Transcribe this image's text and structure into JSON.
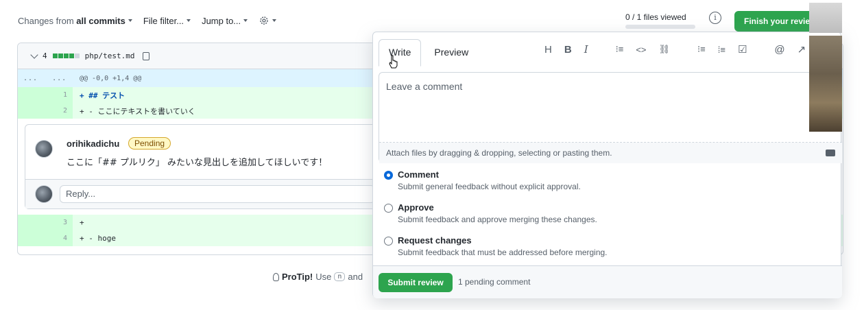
{
  "toolbar": {
    "changes_from": "Changes from",
    "all_commits": "all commits",
    "file_filter": "File filter...",
    "jump_to": "Jump to...",
    "files_viewed": "0 / 1 files viewed",
    "files_viewed_progress": 0,
    "finish_review": "Finish your revie"
  },
  "file": {
    "changes_count": "4",
    "diffstat_added_blocks": 4,
    "path": "php/test.md",
    "hunk_dots_left": "...",
    "hunk_dots_right": "...",
    "hunk_header": "@@ -0,0 +1,4 @@",
    "lines": [
      {
        "num": "1",
        "code": "+ ## テスト"
      },
      {
        "num": "2",
        "code": "+ - ここにテキストを書いていく"
      },
      {
        "num": "3",
        "code": "+"
      },
      {
        "num": "4",
        "code": "+ - hoge"
      }
    ]
  },
  "thread": {
    "author": "orihikadichu",
    "badge": "Pending",
    "body": "ここに「## プルリク」 みたいな見出しを追加してほしいです！",
    "reply_placeholder": "Reply..."
  },
  "protip": {
    "label": "ProTip!",
    "text": "Use",
    "key": "n",
    "tail": "and"
  },
  "review": {
    "tabs": [
      "Write",
      "Preview"
    ],
    "active_tab": "Write",
    "toolbar_icons": [
      "heading-icon",
      "bold-icon",
      "italic-icon",
      "quote-icon",
      "code-icon",
      "link-icon",
      "bulleted-list-icon",
      "numbered-list-icon",
      "task-list-icon",
      "mention-icon",
      "reference-icon"
    ],
    "format_glyphs": {
      "heading": "H",
      "bold": "B",
      "italic": "I",
      "quote": "⁝≡",
      "code": "<>",
      "link": "⛓",
      "bullets": "⁝≡",
      "numbered": "⁞≡",
      "task": "☑",
      "mention": "@",
      "reference": "↗"
    },
    "comment_placeholder": "Leave a comment",
    "attach_text": "Attach files by dragging & dropping, selecting or pasting them.",
    "options": [
      {
        "title": "Comment",
        "desc": "Submit general feedback without explicit approval.",
        "checked": true
      },
      {
        "title": "Approve",
        "desc": "Submit feedback and approve merging these changes.",
        "checked": false
      },
      {
        "title": "Request changes",
        "desc": "Submit feedback that must be addressed before merging.",
        "checked": false
      }
    ],
    "submit_label": "Submit review",
    "pending_count": "1 pending comment"
  },
  "colors": {
    "primary_green": "#2da44e",
    "accent_blue": "#0969da",
    "pending_bg": "#fff8c5",
    "diff_add_bg": "#e6ffec",
    "hunk_bg": "#ddf4ff"
  }
}
